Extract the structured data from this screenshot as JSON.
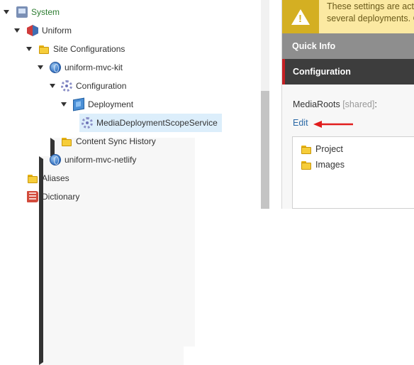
{
  "tree": {
    "system": "System",
    "uniform": "Uniform",
    "site_configurations": "Site Configurations",
    "uniform_mvc_kit": "uniform-mvc-kit",
    "configuration": "Configuration",
    "deployment": "Deployment",
    "media_service": "MediaDeploymentScopeService",
    "content_sync_history": "Content Sync History",
    "uniform_mvc_netlify": "uniform-mvc-netlify",
    "aliases": "Aliases",
    "dictionary": "Dictionary"
  },
  "warning": {
    "line1": "These settings are acti",
    "line2": "several deployments. Cha"
  },
  "sections": {
    "quick_info": "Quick Info",
    "configuration": "Configuration"
  },
  "field": {
    "label": "MediaRoots",
    "shared": "[shared]",
    "colon": ":",
    "edit": "Edit",
    "items": [
      "Project",
      "Images"
    ]
  },
  "colors": {
    "accent_red": "#c32024",
    "warning_bg": "#fbe9a2",
    "link": "#2c6aa6",
    "selected_bg": "#dceefb"
  }
}
